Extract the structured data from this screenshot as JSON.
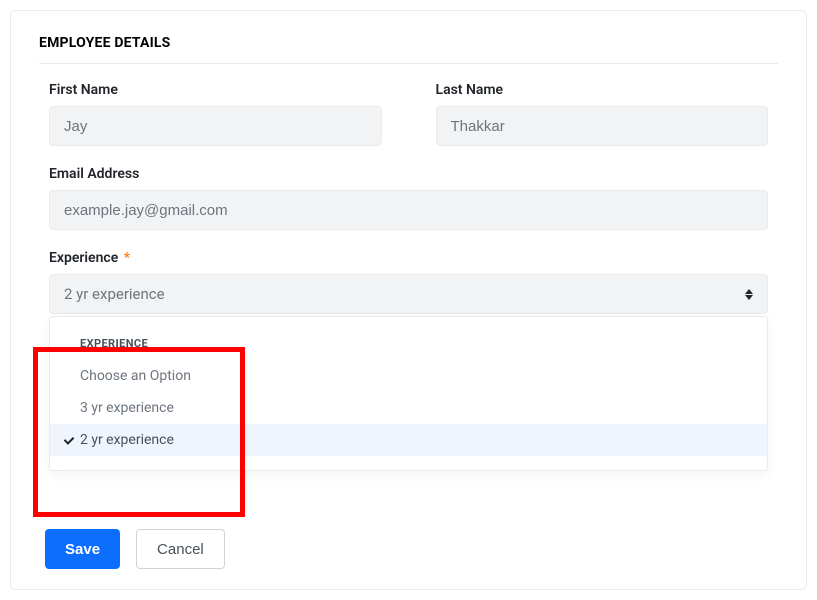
{
  "section_title": "EMPLOYEE DETAILS",
  "fields": {
    "first_name": {
      "label": "First Name",
      "value": "Jay"
    },
    "last_name": {
      "label": "Last Name",
      "value": "Thakkar"
    },
    "email": {
      "label": "Email Address",
      "value": "example.jay@gmail.com"
    },
    "experience": {
      "label": "Experience",
      "required_mark": "*",
      "selected": "2 yr experience",
      "dropdown_header": "EXPERIENCE",
      "options": [
        {
          "label": "Choose an Option",
          "selected": false
        },
        {
          "label": "3 yr experience",
          "selected": false
        },
        {
          "label": "2 yr experience",
          "selected": true
        }
      ]
    }
  },
  "buttons": {
    "save": "Save",
    "cancel": "Cancel"
  }
}
